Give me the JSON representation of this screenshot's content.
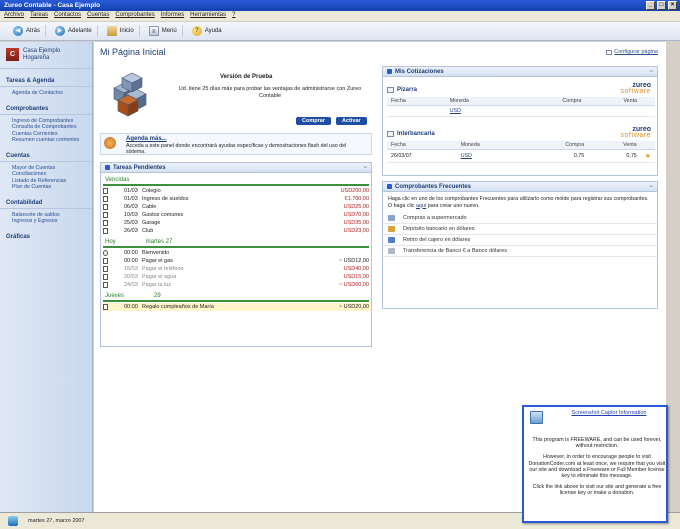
{
  "window": {
    "title": "Zureo Contable - Casa Ejemplo"
  },
  "menu": [
    "Archivo",
    "Tareas",
    "Contactos",
    "Cuentas",
    "Comprobantes",
    "Informes",
    "Herramientas",
    "?"
  ],
  "toolbar": {
    "back": "Atrás",
    "forward": "Adelante",
    "home": "Inicio",
    "menu": "Menú",
    "help": "Ayuda"
  },
  "sidebar": {
    "company_name": "Casa Ejemplo",
    "company_sub": "Hogareña",
    "sections": [
      {
        "title": "Tareas & Agenda",
        "items": [
          "Agenda de Contactos"
        ]
      },
      {
        "title": "Comprobantes",
        "items": [
          "Ingreso de Comprobantes",
          "Consulta de Comprobantes",
          "Cuentas Corrientes",
          "Resumen cuentas corrientes"
        ]
      },
      {
        "title": "Cuentas",
        "items": [
          "Mayor de Cuentas",
          "Conciliaciones",
          "Listado de Referencias",
          "Plan de Cuentas"
        ]
      },
      {
        "title": "Contabilidad",
        "items": [
          "Balancete de saldos",
          "Ingresos y Egresos"
        ]
      },
      {
        "title": "Gráficas",
        "items": []
      }
    ]
  },
  "main": {
    "title": "Mi Página Inicial",
    "config_link": "Configurar página",
    "trial": {
      "title": "Versión de Prueba",
      "text": "Ud. tiene 25 días más para probar las ventajas de administrarse con Zureo Contable",
      "buy": "Comprar",
      "activate": "Activar"
    },
    "promo": {
      "title": "Agenda más...",
      "text": "Acceda a este panel donde encontrará ayudas específicas y demostraciones flash del uso del sistema."
    },
    "tasks": {
      "title": "Tareas Pendientes",
      "groups": [
        {
          "label": "Vencidas",
          "sub": "",
          "rows": [
            {
              "date": "01/03",
              "desc": "Colegio",
              "amount": "USD200,00",
              "muted": false
            },
            {
              "date": "01/03",
              "desc": "Ingreso de sueldos",
              "amount": "€1.700,00",
              "muted": false
            },
            {
              "date": "06/03",
              "desc": "Cable",
              "amount": "USD25,00",
              "muted": false
            },
            {
              "date": "10/03",
              "desc": "Gastos comunes",
              "amount": "USD70,00",
              "muted": false
            },
            {
              "date": "25/03",
              "desc": "Garage",
              "amount": "USD35,00",
              "muted": false
            },
            {
              "date": "26/03",
              "desc": "Club",
              "amount": "USD23,00",
              "muted": false
            }
          ]
        },
        {
          "label": "Hoy",
          "sub": "martes 27",
          "rows": [
            {
              "date": "00:00",
              "desc": "Bienvenido",
              "amount": "",
              "muted": false,
              "bell": true
            },
            {
              "date": "00:00",
              "desc": "Pagar el gas",
              "amount": "~ USD12,00",
              "muted": false
            },
            {
              "date": "15/03",
              "desc": "Pagar el teléfono",
              "amount": "USD40,00",
              "muted": true
            },
            {
              "date": "20/03",
              "desc": "Pagar el agua",
              "amount": "USD15,00",
              "muted": true
            },
            {
              "date": "24/03",
              "desc": "Pagar la luz",
              "amount": "~ USD60,00",
              "muted": true
            }
          ]
        },
        {
          "label": "Jueves",
          "sub": "29",
          "rows": [
            {
              "date": "00:00",
              "desc": "Regalo cumpleaños de María",
              "amount": "~ USD20,00",
              "muted": false,
              "highlight": true
            }
          ]
        }
      ]
    },
    "cotizaciones": {
      "title": "Mis Cotizaciones",
      "headers": [
        "Fecha",
        "Moneda",
        "Compra",
        "Venta"
      ],
      "blocks": [
        {
          "name": "Pizarra",
          "brand": "zureo",
          "brand_sub": "software",
          "rows": [
            {
              "date": "",
              "currency": "USD",
              "buy": "",
              "sell": ""
            }
          ]
        },
        {
          "name": "Interbancaria",
          "brand": "zureo",
          "brand_sub": "software",
          "rows": [
            {
              "date": "26/03/07",
              "currency": "USD",
              "buy": "0,75",
              "sell": "0,75"
            }
          ]
        }
      ]
    },
    "frecuentes": {
      "title": "Comprobantes Frecuentes",
      "intro_a": "Haga clic en uno de los comprobantes Frecuentes para utilizarlo como molde para registrar sus comprobantes. O haga clic",
      "intro_link": "aquí",
      "intro_b": "para crear uno nuevo.",
      "items": [
        "Compras a supermercado",
        "Depósito bancario en dólares",
        "Retiro del cajero en dólares",
        "Transferencia de Banco € a Banco dólares"
      ]
    }
  },
  "status": {
    "date": "martes 27, marzo 2007"
  },
  "popup": {
    "link": "Screenshot Captor Information",
    "p1": "This program is FREEWARE, and can be used forever, without restriction.",
    "p2": "However, in order to encourage people to visit DonationCoder.com at least once, we require that you visit our site and download a Freeware or Full Member license key to eliminate this message.",
    "p3": "Click the link above to visit our site and generate a free license key or make a donation."
  }
}
